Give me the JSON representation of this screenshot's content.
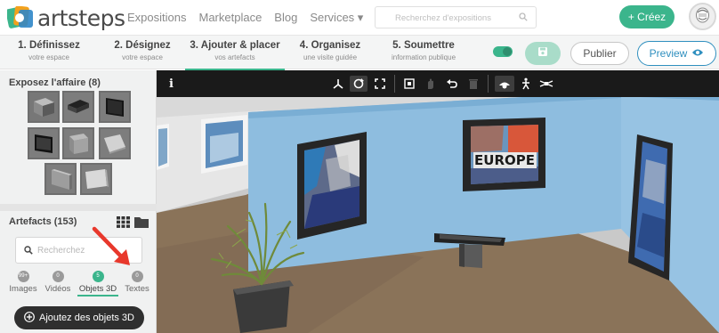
{
  "app": {
    "logo_text": "artsteps"
  },
  "nav": {
    "links": [
      "Expositions",
      "Marketplace",
      "Blog",
      "Services ▾"
    ],
    "search_placeholder": "Recherchez d'expositions",
    "create_label": "+ Créez"
  },
  "steps": [
    {
      "title": "1. Définissez",
      "subtitle": "votre espace"
    },
    {
      "title": "2. Désignez",
      "subtitle": "votre espace"
    },
    {
      "title": "3. Ajouter & placer",
      "subtitle": "vos artefacts"
    },
    {
      "title": "4. Organisez",
      "subtitle": "une visite guidée"
    },
    {
      "title": "5. Soumettre",
      "subtitle": "information publique"
    }
  ],
  "actions": {
    "publish_label": "Publier",
    "preview_label": "Preview"
  },
  "left_panel": {
    "affaire_title": "Exposez l'affaire (8)",
    "artefacts_title": "Artefacts (153)",
    "search_placeholder": "Recherchez",
    "categories": [
      {
        "count": "99+",
        "label": "Images"
      },
      {
        "count": "0",
        "label": "Vidéos"
      },
      {
        "count": "5",
        "label": "Objets 3D"
      },
      {
        "count": "0",
        "label": "Textes"
      }
    ],
    "add_button_label": "Ajoutez des objets 3D"
  },
  "viewport": {
    "info_label": "i",
    "painting_center_text": "EUROPE"
  },
  "colors": {
    "accent": "#3bb58c",
    "preview_blue": "#2f8fbf",
    "wall_blue": "#88b9de",
    "floor": "#8a7359",
    "arrow_red": "#e8382c"
  },
  "icons": [
    "logo-mark",
    "search-icon",
    "avatar-icon",
    "save-icon",
    "eye-icon",
    "grid-icon",
    "folder-icon",
    "plus-circle-icon",
    "move-icon",
    "rotate-icon",
    "scale-icon",
    "copy-icon",
    "hand-icon",
    "undo-icon",
    "trash-icon",
    "view-mode-icon",
    "walk-icon",
    "drone-icon"
  ]
}
